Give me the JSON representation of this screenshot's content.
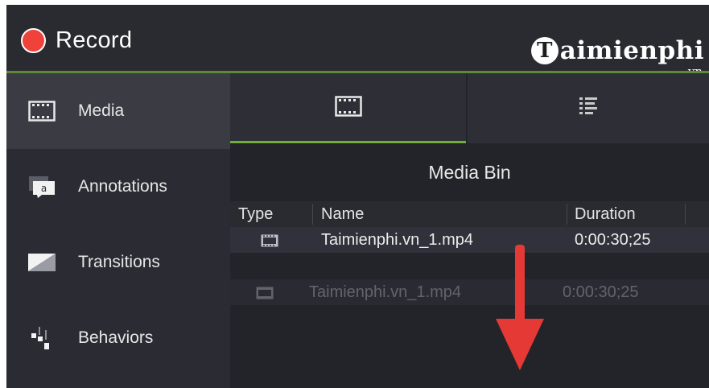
{
  "toolbar": {
    "record_label": "Record"
  },
  "watermark": {
    "badge": "T",
    "text": "aimienphi",
    "sub": ".vn"
  },
  "sidebar": {
    "items": [
      {
        "label": "Media",
        "icon": "film-icon"
      },
      {
        "label": "Annotations",
        "icon": "annotation-icon"
      },
      {
        "label": "Transitions",
        "icon": "transition-icon"
      },
      {
        "label": "Behaviors",
        "icon": "behaviors-icon"
      }
    ]
  },
  "tabs": [
    {
      "icon": "film-icon",
      "active": true
    },
    {
      "icon": "list-icon",
      "active": false
    }
  ],
  "media_bin": {
    "title": "Media Bin",
    "columns": {
      "type": "Type",
      "name": "Name",
      "duration": "Duration"
    },
    "rows": [
      {
        "type_icon": "film-icon",
        "name": "Taimienphi.vn_1.mp4",
        "duration": "0:00:30;25"
      }
    ],
    "drag_preview": {
      "type_icon": "film-icon",
      "name": "Taimienphi.vn_1.mp4",
      "duration": "0:00:30;25"
    }
  },
  "colors": {
    "record": "#f0413b",
    "accent_green": "#6fae3a",
    "arrow": "#e53935",
    "panel": "#2b2c33"
  }
}
